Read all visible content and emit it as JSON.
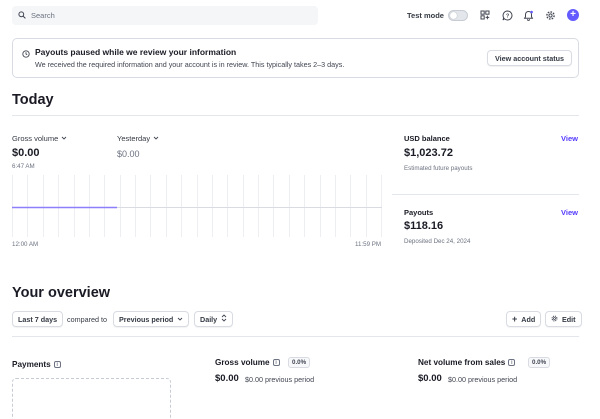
{
  "topbar": {
    "search_placeholder": "Search",
    "test_mode_label": "Test mode",
    "test_mode_on": false,
    "accent_color": "#635bff"
  },
  "banner": {
    "title": "Payouts paused while we review your information",
    "description": "We received the required information and your account is in review. This typically takes 2–3 days.",
    "button_label": "View account status"
  },
  "today": {
    "heading": "Today",
    "gross_volume": {
      "label": "Gross volume",
      "value": "$0.00",
      "time": "6:47 AM"
    },
    "yesterday": {
      "label": "Yesterday",
      "value": "$0.00"
    },
    "chart": {
      "start_label": "12:00 AM",
      "end_label": "11:59 PM"
    },
    "usd_balance": {
      "label": "USD balance",
      "value": "$1,023.72",
      "sub": "Estimated future payouts",
      "link": "View"
    },
    "payouts": {
      "label": "Payouts",
      "value": "$118.16",
      "sub": "Deposited Dec 24, 2024",
      "link": "View"
    }
  },
  "overview": {
    "heading": "Your overview",
    "range_button": "Last 7 days",
    "compared_to_label": "compared to",
    "compare_select": "Previous period",
    "interval_select": "Daily",
    "add_button": "Add",
    "edit_button": "Edit",
    "cards": [
      {
        "title": "Payments"
      },
      {
        "title": "Gross volume",
        "badge": "0.0%",
        "value": "$0.00",
        "previous": "$0.00 previous period"
      },
      {
        "title": "Net volume from sales",
        "badge": "0.0%",
        "value": "$0.00",
        "previous": "$0.00 previous period"
      }
    ]
  }
}
